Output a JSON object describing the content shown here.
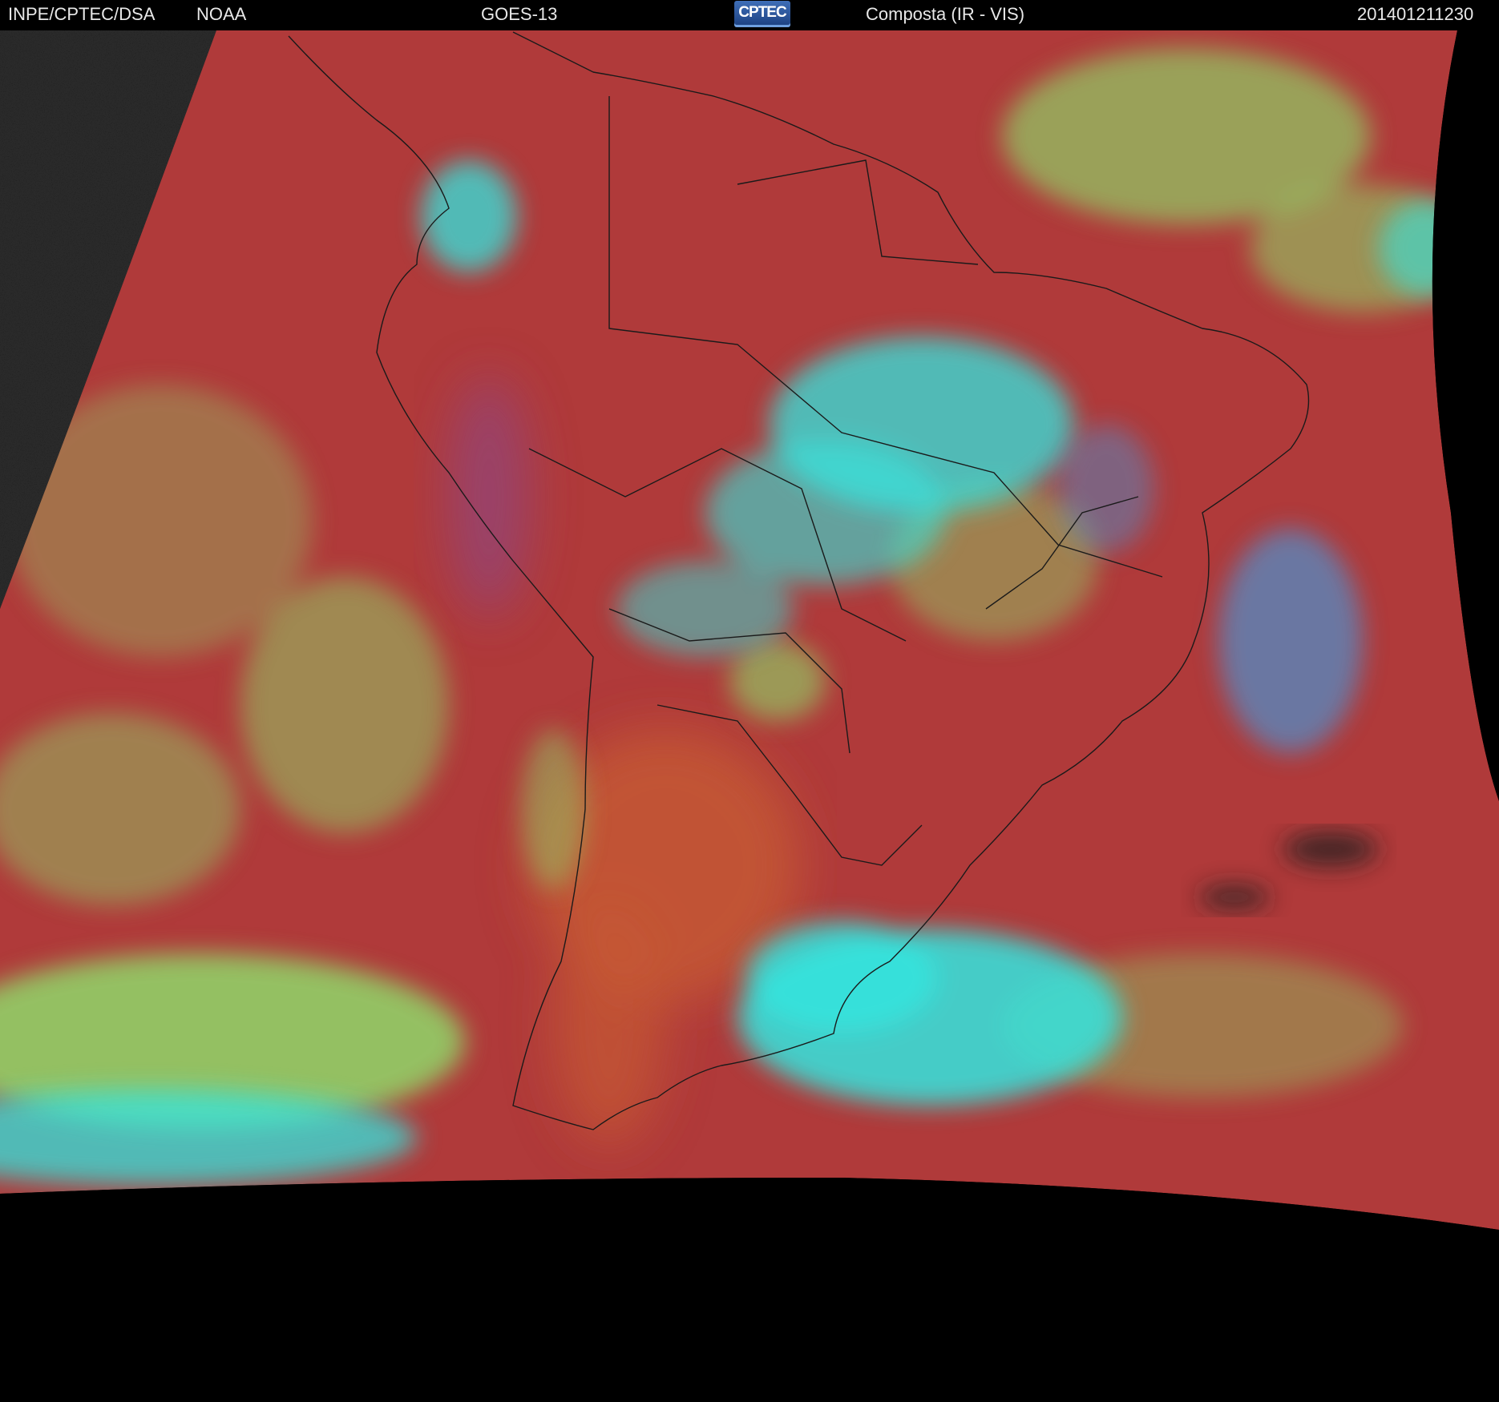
{
  "header": {
    "institution": "INPE/CPTEC/DSA",
    "agency": "NOAA",
    "satellite": "GOES-13",
    "logo_text": "CPTEC",
    "product": "Composta (IR - VIS)",
    "timestamp": "201401211230"
  },
  "image": {
    "kind": "satellite-composite",
    "colors": {
      "clear_surface": "#b03a3a",
      "land_warm": "#c65a35",
      "low_cloud": "#8fd86a",
      "high_cloud": "#33e6e0",
      "cold_cloud_blue": "#3aa0e8",
      "night_side": "#2a2a2a",
      "no_data": "#000000",
      "borders": "#1a1a1a"
    }
  }
}
